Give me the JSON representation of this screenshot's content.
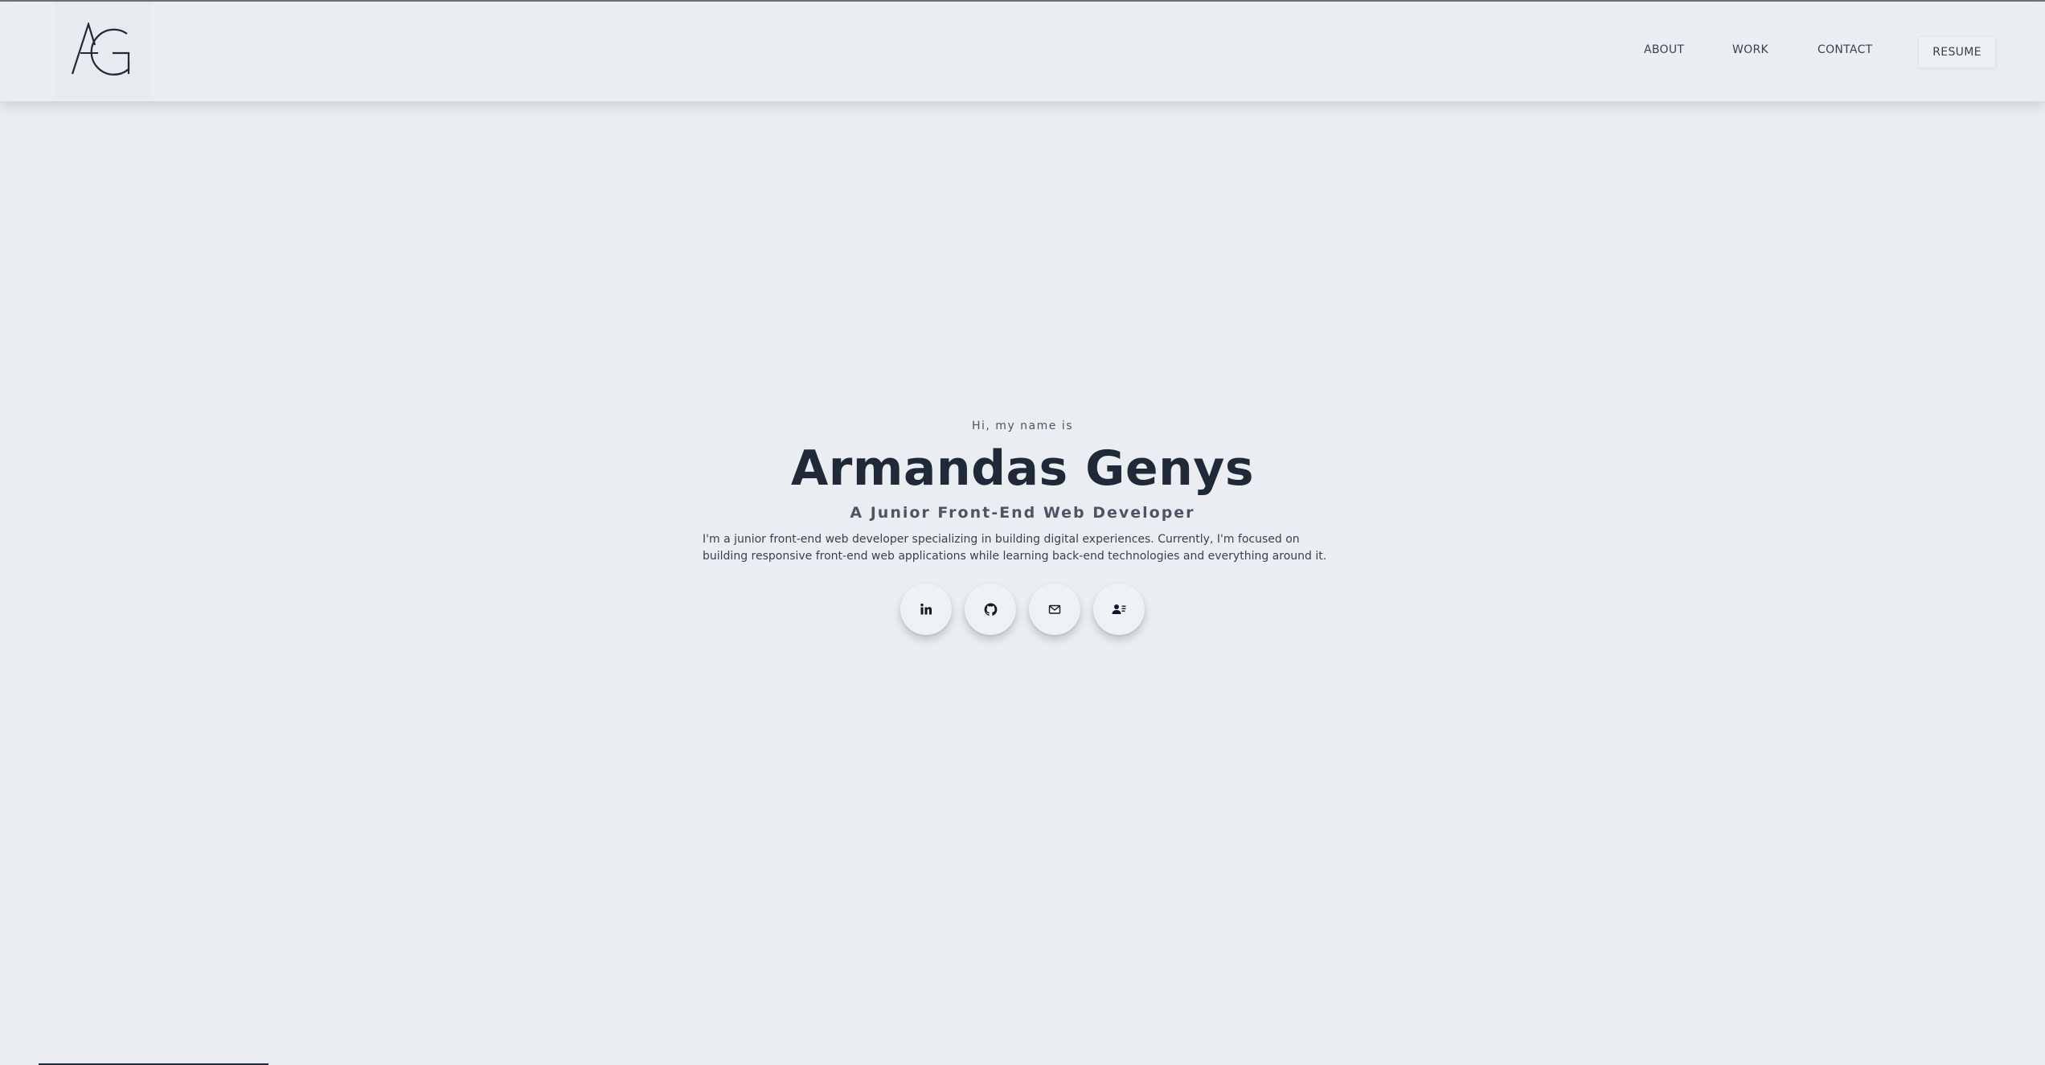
{
  "header": {
    "logo_text": "AG",
    "logo_icon": "ag-monogram-logo",
    "nav": [
      {
        "label": "ABOUT"
      },
      {
        "label": "WORK"
      },
      {
        "label": "CONTACT"
      }
    ],
    "resume_label": "RESUME"
  },
  "hero": {
    "intro": "Hi, my name is",
    "name": "Armandas Genys",
    "role": "A Junior Front-End Web Developer",
    "description": "I'm a junior front-end web developer specializing in building digital experiences. Currently, I'm focused on building responsive front-end web applications while learning back-end technologies and everything around it."
  },
  "socials": [
    {
      "icon": "linkedin-icon"
    },
    {
      "icon": "github-icon"
    },
    {
      "icon": "mail-icon"
    },
    {
      "icon": "contact-card-icon"
    }
  ],
  "colors": {
    "background": "#eaeef2",
    "text_dark": "#1f2937",
    "text_muted": "#4b5563"
  }
}
